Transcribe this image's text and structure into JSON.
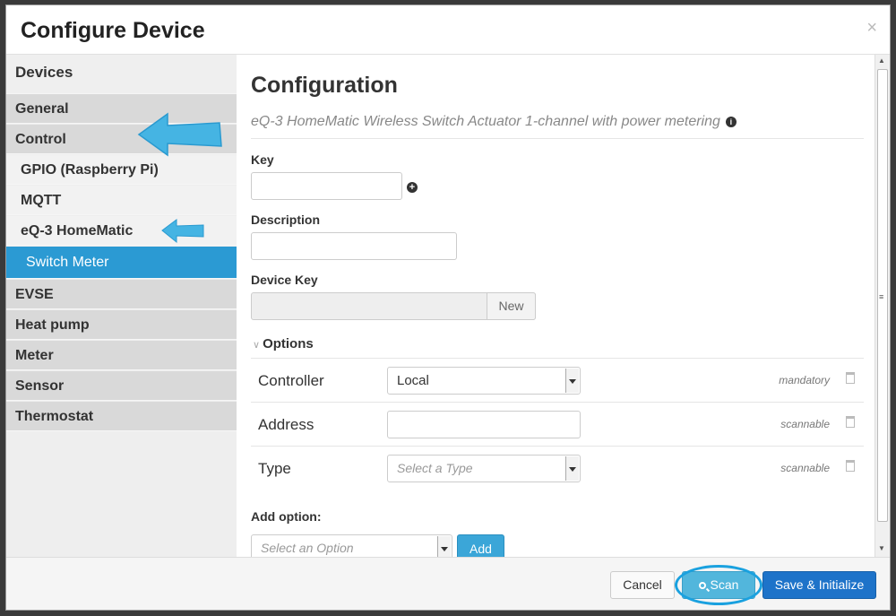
{
  "modal": {
    "title": "Configure Device",
    "close": "×"
  },
  "sidebar": {
    "heading": "Devices",
    "items": [
      {
        "label": "General"
      },
      {
        "label": "Control"
      },
      {
        "label": "GPIO (Raspberry Pi)"
      },
      {
        "label": "MQTT"
      },
      {
        "label": "eQ-3 HomeMatic"
      },
      {
        "label": "Switch Meter"
      },
      {
        "label": "EVSE"
      },
      {
        "label": "Heat pump"
      },
      {
        "label": "Meter"
      },
      {
        "label": "Sensor"
      },
      {
        "label": "Thermostat"
      }
    ]
  },
  "main": {
    "heading": "Configuration",
    "subtitle": "eQ-3 HomeMatic Wireless Switch Actuator 1-channel with power metering",
    "key_label": "Key",
    "key_value": "",
    "description_label": "Description",
    "description_value": "",
    "device_key_label": "Device Key",
    "device_key_value": "",
    "new_button": "New",
    "options_label": "Options",
    "options": [
      {
        "name": "Controller",
        "value": "Local",
        "badge": "mandatory"
      },
      {
        "name": "Address",
        "value": "",
        "badge": "scannable"
      },
      {
        "name": "Type",
        "placeholder": "Select a Type",
        "badge": "scannable"
      }
    ],
    "add_option_label": "Add option:",
    "add_option_placeholder": "Select an Option",
    "add_button": "Add"
  },
  "footer": {
    "cancel": "Cancel",
    "scan": "Scan",
    "save": "Save & Initialize"
  },
  "colors": {
    "accent": "#2b9ad3",
    "primary": "#1e73c9",
    "annotation": "#1aa1df"
  }
}
